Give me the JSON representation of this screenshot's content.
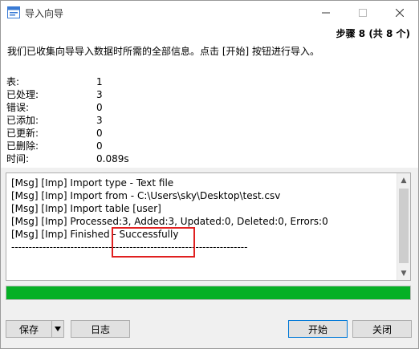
{
  "window": {
    "title": "导入向导"
  },
  "header": {
    "step": "步骤 8 (共 8 个)",
    "intro": "我们已收集向导导入数据时所需的全部信息。点击 [开始] 按钮进行导入。"
  },
  "stats": [
    {
      "label": "表:",
      "value": "1"
    },
    {
      "label": "已处理:",
      "value": "3"
    },
    {
      "label": "错误:",
      "value": "0"
    },
    {
      "label": "已添加:",
      "value": "3"
    },
    {
      "label": "已更新:",
      "value": "0"
    },
    {
      "label": "已删除:",
      "value": "0"
    },
    {
      "label": "时间:",
      "value": "0.089s"
    }
  ],
  "log": {
    "lines": [
      "[Msg] [Imp] Import type - Text file",
      "[Msg] [Imp] Import from - C:\\Users\\sky\\Desktop\\test.csv",
      "[Msg] [Imp] Import table [user]",
      "[Msg] [Imp] Processed:3, Added:3, Updated:0, Deleted:0, Errors:0",
      "[Msg] [Imp] Finished - Successfully",
      "--------------------------------------------------------------------"
    ]
  },
  "progress": {
    "percent": 100,
    "color": "#06b025"
  },
  "buttons": {
    "save": "保存",
    "log": "日志",
    "start": "开始",
    "close": "关闭"
  },
  "colors": {
    "highlight": "#e02020",
    "primary_border": "#0078d7"
  }
}
